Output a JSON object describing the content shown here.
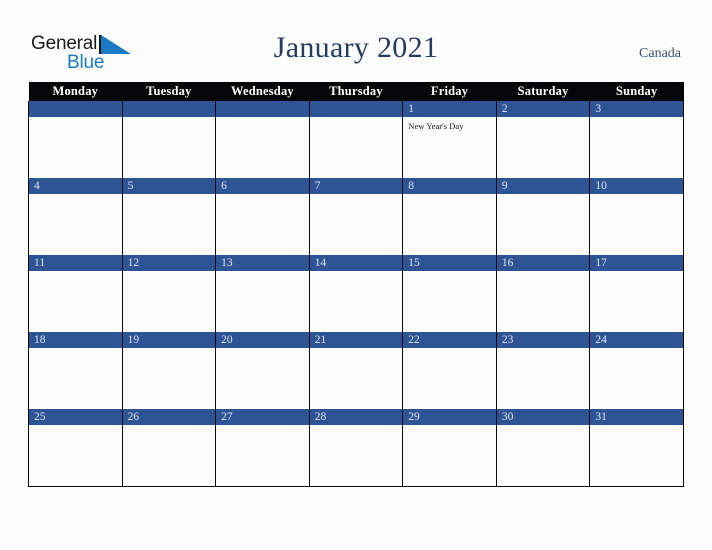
{
  "brand": {
    "name_part1": "General",
    "name_part2": "Blue",
    "triangle_color": "#1a7ac4",
    "text_color": "#1b1b1b"
  },
  "header": {
    "title": "January 2021",
    "region": "Canada",
    "title_color": "#273c60",
    "region_color": "#3d5176"
  },
  "calendar": {
    "accent_color": "#2f5496",
    "header_bg": "#060608",
    "cell_bg": "#fdfdfd",
    "weekday_headers": [
      "Monday",
      "Tuesday",
      "Wednesday",
      "Thursday",
      "Friday",
      "Saturday",
      "Sunday"
    ],
    "weeks": [
      [
        {
          "day": "",
          "events": []
        },
        {
          "day": "",
          "events": []
        },
        {
          "day": "",
          "events": []
        },
        {
          "day": "",
          "events": []
        },
        {
          "day": "1",
          "events": [
            "New Year's Day"
          ]
        },
        {
          "day": "2",
          "events": []
        },
        {
          "day": "3",
          "events": []
        }
      ],
      [
        {
          "day": "4",
          "events": []
        },
        {
          "day": "5",
          "events": []
        },
        {
          "day": "6",
          "events": []
        },
        {
          "day": "7",
          "events": []
        },
        {
          "day": "8",
          "events": []
        },
        {
          "day": "9",
          "events": []
        },
        {
          "day": "10",
          "events": []
        }
      ],
      [
        {
          "day": "11",
          "events": []
        },
        {
          "day": "12",
          "events": []
        },
        {
          "day": "13",
          "events": []
        },
        {
          "day": "14",
          "events": []
        },
        {
          "day": "15",
          "events": []
        },
        {
          "day": "16",
          "events": []
        },
        {
          "day": "17",
          "events": []
        }
      ],
      [
        {
          "day": "18",
          "events": []
        },
        {
          "day": "19",
          "events": []
        },
        {
          "day": "20",
          "events": []
        },
        {
          "day": "21",
          "events": []
        },
        {
          "day": "22",
          "events": []
        },
        {
          "day": "23",
          "events": []
        },
        {
          "day": "24",
          "events": []
        }
      ],
      [
        {
          "day": "25",
          "events": []
        },
        {
          "day": "26",
          "events": []
        },
        {
          "day": "27",
          "events": []
        },
        {
          "day": "28",
          "events": []
        },
        {
          "day": "29",
          "events": []
        },
        {
          "day": "30",
          "events": []
        },
        {
          "day": "31",
          "events": []
        }
      ]
    ]
  }
}
